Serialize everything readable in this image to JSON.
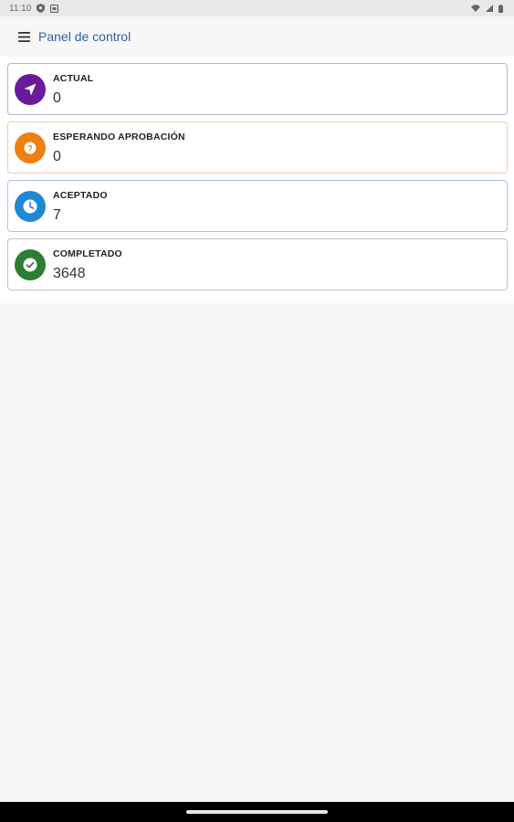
{
  "status_bar": {
    "time": "11:10",
    "icons": [
      "shield-icon",
      "notification-icon",
      "wifi-icon",
      "signal-icon",
      "battery-icon"
    ]
  },
  "app_bar": {
    "title": "Panel de control",
    "menu_icon": "menu-icon"
  },
  "cards": [
    {
      "label": "ACTUAL",
      "value": "0",
      "icon": "navigation-arrow-icon",
      "color": "#6a1b9a",
      "border": "#b8b8cc"
    },
    {
      "label": "ESPERANDO APROBACIÓN",
      "value": "0",
      "icon": "question-icon",
      "color": "#ef7f12",
      "border": "#f3c9a8"
    },
    {
      "label": "ACEPTADO",
      "value": "7",
      "icon": "clock-icon",
      "color": "#1e88d5",
      "border": "#a9c6e6"
    },
    {
      "label": "COMPLETADO",
      "value": "3648",
      "icon": "check-icon",
      "color": "#2e7d32",
      "border": "#bcc6bc"
    }
  ],
  "colors": {
    "title": "#2f5fa3",
    "background": "#f7f7f7"
  }
}
